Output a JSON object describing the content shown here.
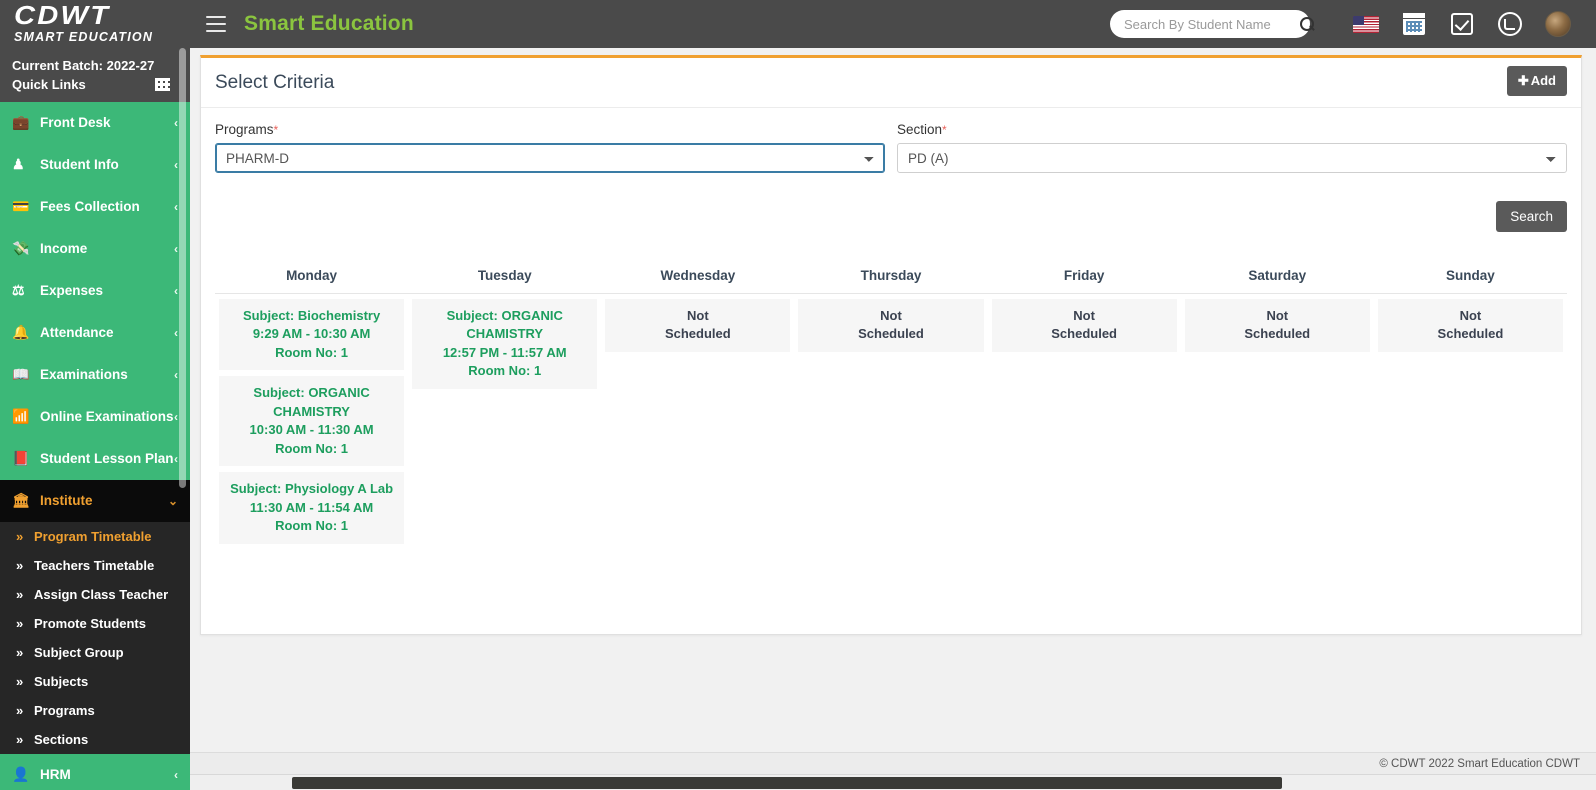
{
  "header": {
    "logo_main": "CDWT",
    "logo_sub": "SMART EDUCATION",
    "menu_icon": "hamburger-icon",
    "app_title": "Smart Education",
    "search_placeholder": "Search By Student Name",
    "search_value": "",
    "icons": [
      {
        "name": "flag-icon",
        "label": "US"
      },
      {
        "name": "calendar-icon",
        "label": "Calendar"
      },
      {
        "name": "checkbox-icon",
        "label": "Tasks"
      },
      {
        "name": "whatsapp-icon",
        "label": "WhatsApp"
      },
      {
        "name": "avatar",
        "label": "Profile"
      }
    ]
  },
  "sidebar": {
    "batch_label": "Current Batch: 2022-27",
    "quick_links_label": "Quick Links",
    "quick_links_icon": "grid-icon",
    "items": [
      {
        "label": "Front Desk",
        "icon": "briefcase-icon",
        "caret": "‹"
      },
      {
        "label": "Student Info",
        "icon": "person-icon",
        "caret": "‹"
      },
      {
        "label": "Fees Collection",
        "icon": "card-icon",
        "caret": "‹"
      },
      {
        "label": "Income",
        "icon": "visa-icon",
        "caret": "‹"
      },
      {
        "label": "Expenses",
        "icon": "scale-icon",
        "caret": "‹"
      },
      {
        "label": "Attendance",
        "icon": "bell-icon",
        "caret": "‹"
      },
      {
        "label": "Examinations",
        "icon": "book-icon",
        "caret": "‹"
      },
      {
        "label": "Online Examinations",
        "icon": "rss-icon",
        "caret": "‹"
      },
      {
        "label": "Student Lesson Plan",
        "icon": "notebook-icon",
        "caret": "‹"
      },
      {
        "label": "Institute",
        "icon": "bank-icon",
        "caret": "⌄",
        "active": true
      },
      {
        "label": "HRM",
        "icon": "people-icon",
        "caret": "‹"
      }
    ],
    "submenu": [
      {
        "label": "Program Timetable",
        "active": true
      },
      {
        "label": "Teachers Timetable"
      },
      {
        "label": "Assign Class Teacher"
      },
      {
        "label": "Promote Students"
      },
      {
        "label": "Subject Group"
      },
      {
        "label": "Subjects"
      },
      {
        "label": "Programs"
      },
      {
        "label": "Sections"
      }
    ]
  },
  "card": {
    "title": "Select Criteria",
    "add_button": "Add",
    "add_icon": "plus-icon",
    "search_button": "Search",
    "programs": {
      "label": "Programs",
      "required": "*",
      "value": "PHARM-D",
      "options": [
        "PHARM-D"
      ]
    },
    "section": {
      "label": "Section",
      "required": "*",
      "value": "PD (A)",
      "options": [
        "PD (A)"
      ]
    }
  },
  "timetable": {
    "days": [
      "Monday",
      "Tuesday",
      "Wednesday",
      "Thursday",
      "Friday",
      "Saturday",
      "Sunday"
    ],
    "not_scheduled_line1": "Not",
    "not_scheduled_line2": "Scheduled",
    "columns": [
      {
        "day": "Monday",
        "slots": [
          {
            "subject": "Subject: Biochemistry",
            "time": "9:29 AM - 10:30 AM",
            "room": "Room No: 1"
          },
          {
            "subject": "Subject: ORGANIC CHAMISTRY",
            "time": "10:30 AM - 11:30 AM",
            "room": "Room No: 1"
          },
          {
            "subject": "Subject: Physiology A Lab",
            "time": "11:30 AM - 11:54 AM",
            "room": "Room No: 1"
          }
        ]
      },
      {
        "day": "Tuesday",
        "slots": [
          {
            "subject": "Subject: ORGANIC CHAMISTRY",
            "time": "12:57 PM - 11:57 AM",
            "room": "Room No: 1"
          }
        ]
      },
      {
        "day": "Wednesday",
        "slots": []
      },
      {
        "day": "Thursday",
        "slots": []
      },
      {
        "day": "Friday",
        "slots": []
      },
      {
        "day": "Saturday",
        "slots": []
      },
      {
        "day": "Sunday",
        "slots": []
      }
    ]
  },
  "footer": {
    "copyright": "© CDWT 2022 Smart Education CDWT"
  },
  "colors": {
    "sidebar_green": "#3cb878",
    "header_dark": "#4a4a4a",
    "accent_orange": "#f0a030",
    "title_green": "#8bc53f",
    "slot_green": "#1d9e5e",
    "submenu_dark": "#262626"
  }
}
